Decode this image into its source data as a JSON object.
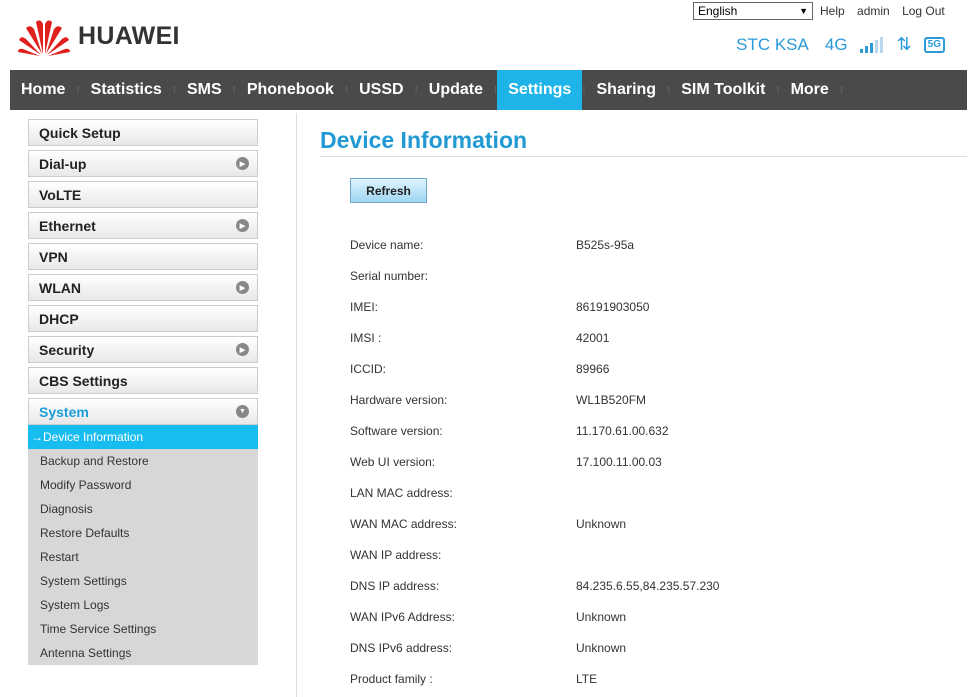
{
  "brand": {
    "name": "HUAWEI",
    "logo_color": "#e0201d"
  },
  "header": {
    "language": "English",
    "help_label": "Help",
    "user_label": "admin",
    "logout_label": "Log Out",
    "operator": "STC KSA",
    "network_type": "4G",
    "signal_bars": 3,
    "signal_max": 5,
    "icons": [
      "signal-icon",
      "data-transfer-icon",
      "5g-icon"
    ],
    "badge_5g": "5G",
    "accent_color": "#2b9ad9"
  },
  "nav": {
    "items": [
      "Home",
      "Statistics",
      "SMS",
      "Phonebook",
      "USSD",
      "Update",
      "Settings",
      "Sharing",
      "SIM Toolkit",
      "More"
    ],
    "active": "Settings",
    "active_color": "#1fb4e9"
  },
  "sidebar": {
    "sections": [
      {
        "label": "Quick Setup",
        "expandable": false
      },
      {
        "label": "Dial-up",
        "expandable": true
      },
      {
        "label": "VoLTE",
        "expandable": false
      },
      {
        "label": "Ethernet",
        "expandable": true
      },
      {
        "label": "VPN",
        "expandable": false
      },
      {
        "label": "WLAN",
        "expandable": true
      },
      {
        "label": "DHCP",
        "expandable": false
      },
      {
        "label": "Security",
        "expandable": true
      },
      {
        "label": "CBS Settings",
        "expandable": false
      },
      {
        "label": "System",
        "expandable": true
      }
    ],
    "system_items": [
      "Device Information",
      "Backup and Restore",
      "Modify Password",
      "Diagnosis",
      "Restore Defaults",
      "Restart",
      "System Settings",
      "System Logs",
      "Time Service Settings",
      "Antenna Settings"
    ],
    "active_item": "Device Information",
    "active_marker": "→"
  },
  "main": {
    "title": "Device Information",
    "refresh_label": "Refresh",
    "rows": [
      {
        "label": "Device name:",
        "value": "B525s-95a"
      },
      {
        "label": "Serial number:",
        "value": ""
      },
      {
        "label": "IMEI:",
        "value": "86191903050"
      },
      {
        "label": "IMSI :",
        "value": "42001"
      },
      {
        "label": "ICCID:",
        "value": "89966"
      },
      {
        "label": "Hardware version:",
        "value": "WL1B520FM"
      },
      {
        "label": "Software version:",
        "value": "11.170.61.00.632"
      },
      {
        "label": "Web UI version:",
        "value": "17.100.11.00.03"
      },
      {
        "label": "LAN MAC address:",
        "value": ""
      },
      {
        "label": "WAN MAC address:",
        "value": "Unknown"
      },
      {
        "label": "WAN IP address:",
        "value": ""
      },
      {
        "label": "DNS IP address:",
        "value": "84.235.6.55,84.235.57.230"
      },
      {
        "label": "WAN IPv6 Address:",
        "value": "Unknown"
      },
      {
        "label": "DNS IPv6 address:",
        "value": "Unknown"
      },
      {
        "label": "Product family :",
        "value": "LTE"
      }
    ]
  }
}
